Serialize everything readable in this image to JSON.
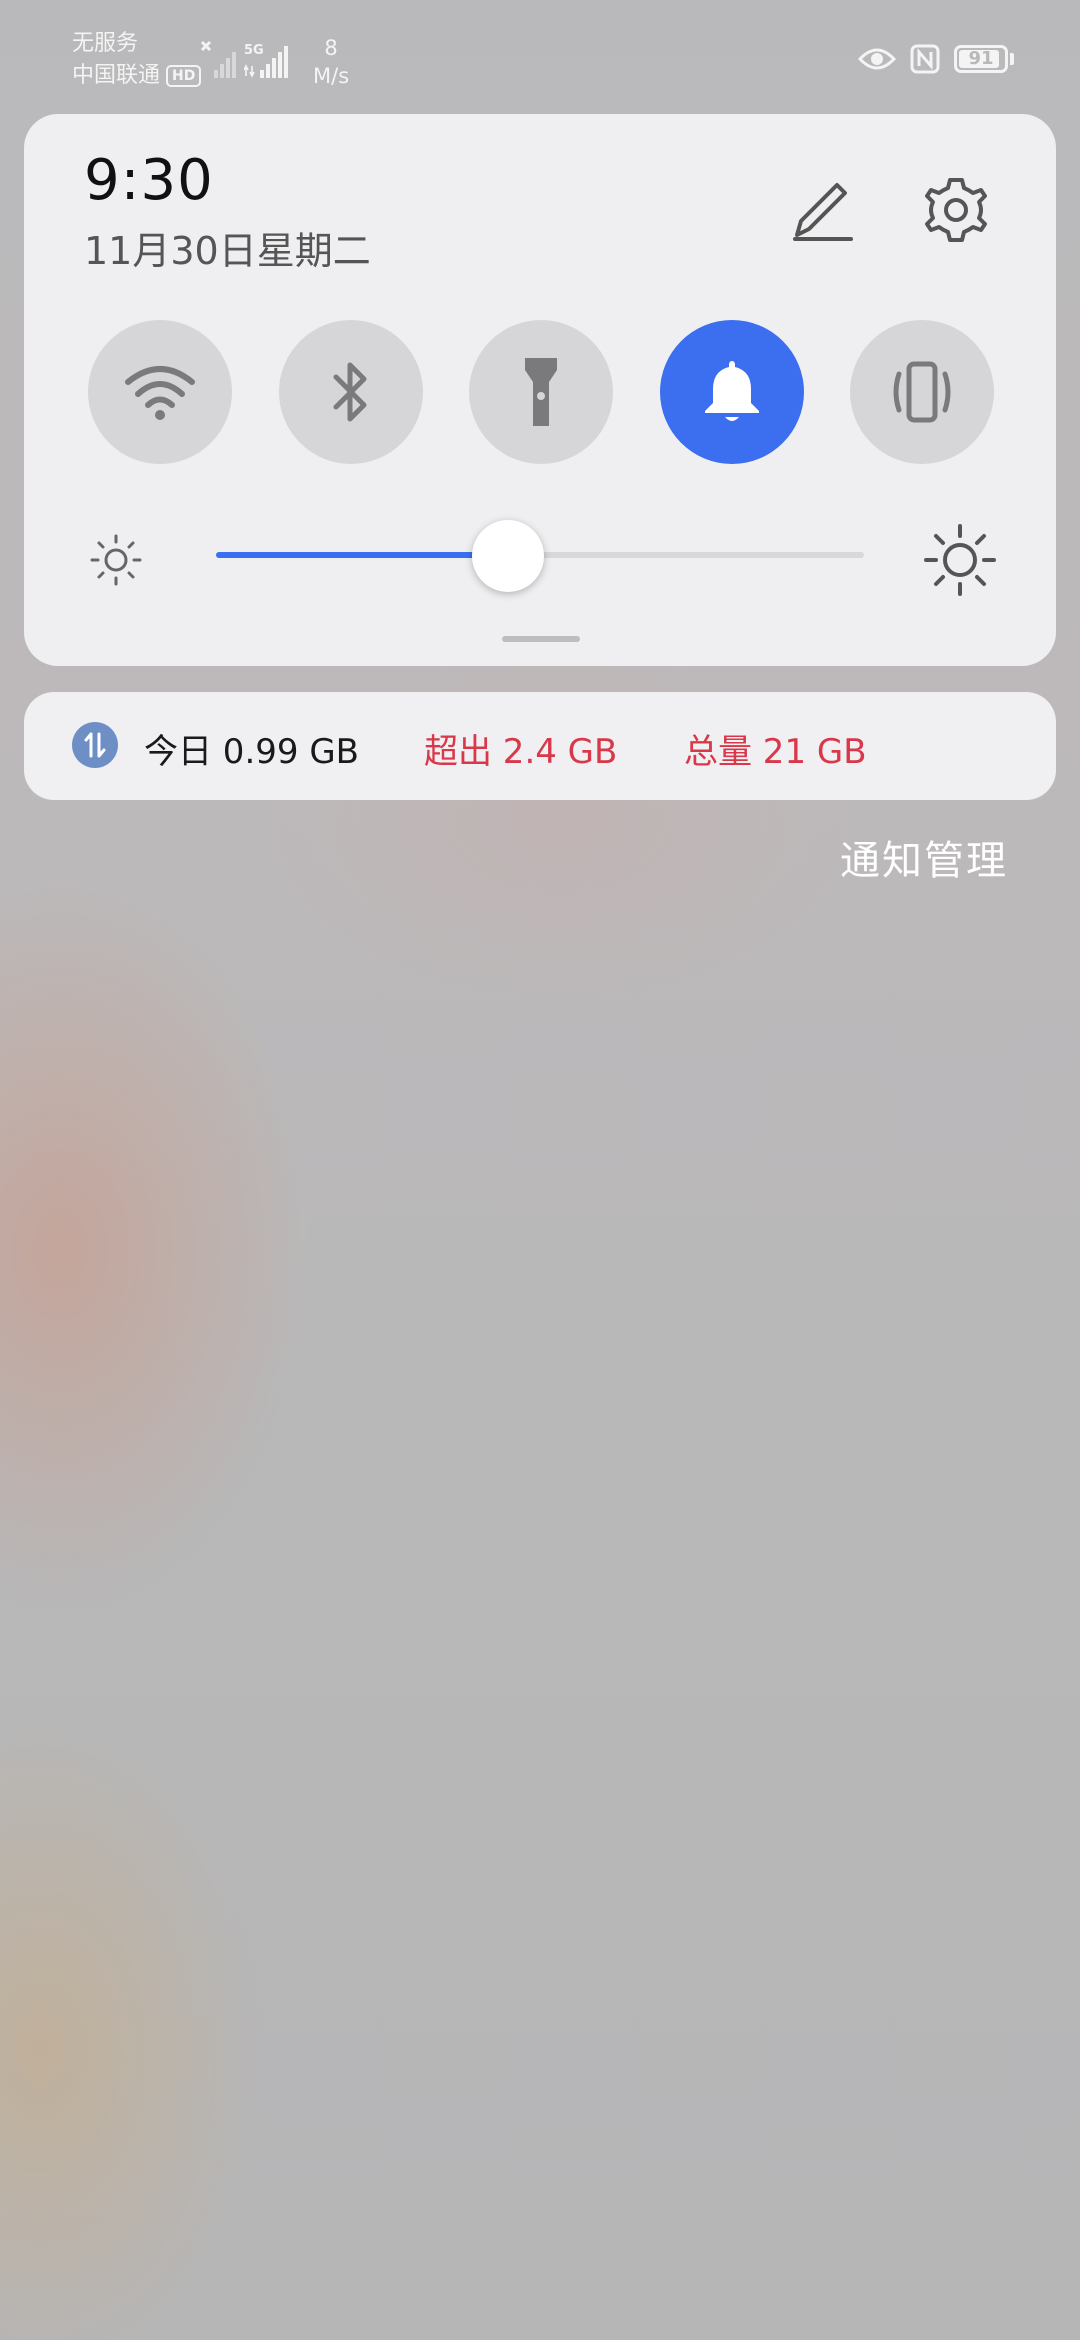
{
  "status_bar": {
    "carrier_line1": "无服务",
    "carrier_line2": "中国联通",
    "hd_badge": "HD",
    "network_type": "5G",
    "speed_value": "8",
    "speed_unit": "M/s",
    "battery_level": "91",
    "icons": [
      "no-signal-icon",
      "signal-5g-icon",
      "eye-icon",
      "nfc-icon",
      "battery-icon"
    ]
  },
  "control_center": {
    "time": "9:30",
    "date": "11月30日星期二",
    "toggles": [
      {
        "name": "wifi",
        "icon": "wifi-icon",
        "active": false
      },
      {
        "name": "bluetooth",
        "icon": "bluetooth-icon",
        "active": false
      },
      {
        "name": "flashlight",
        "icon": "flashlight-icon",
        "active": false
      },
      {
        "name": "sound",
        "icon": "bell-icon",
        "active": true
      },
      {
        "name": "vibrate",
        "icon": "vibrate-icon",
        "active": false
      }
    ],
    "brightness_level": 0.45,
    "accent_color": "#3b6ff0"
  },
  "data_usage": {
    "today": "今日 0.99 GB",
    "exceed": "超出 2.4 GB",
    "total": "总量 21 GB",
    "warning_color": "#d8384a"
  },
  "notification_manage": "通知管理"
}
